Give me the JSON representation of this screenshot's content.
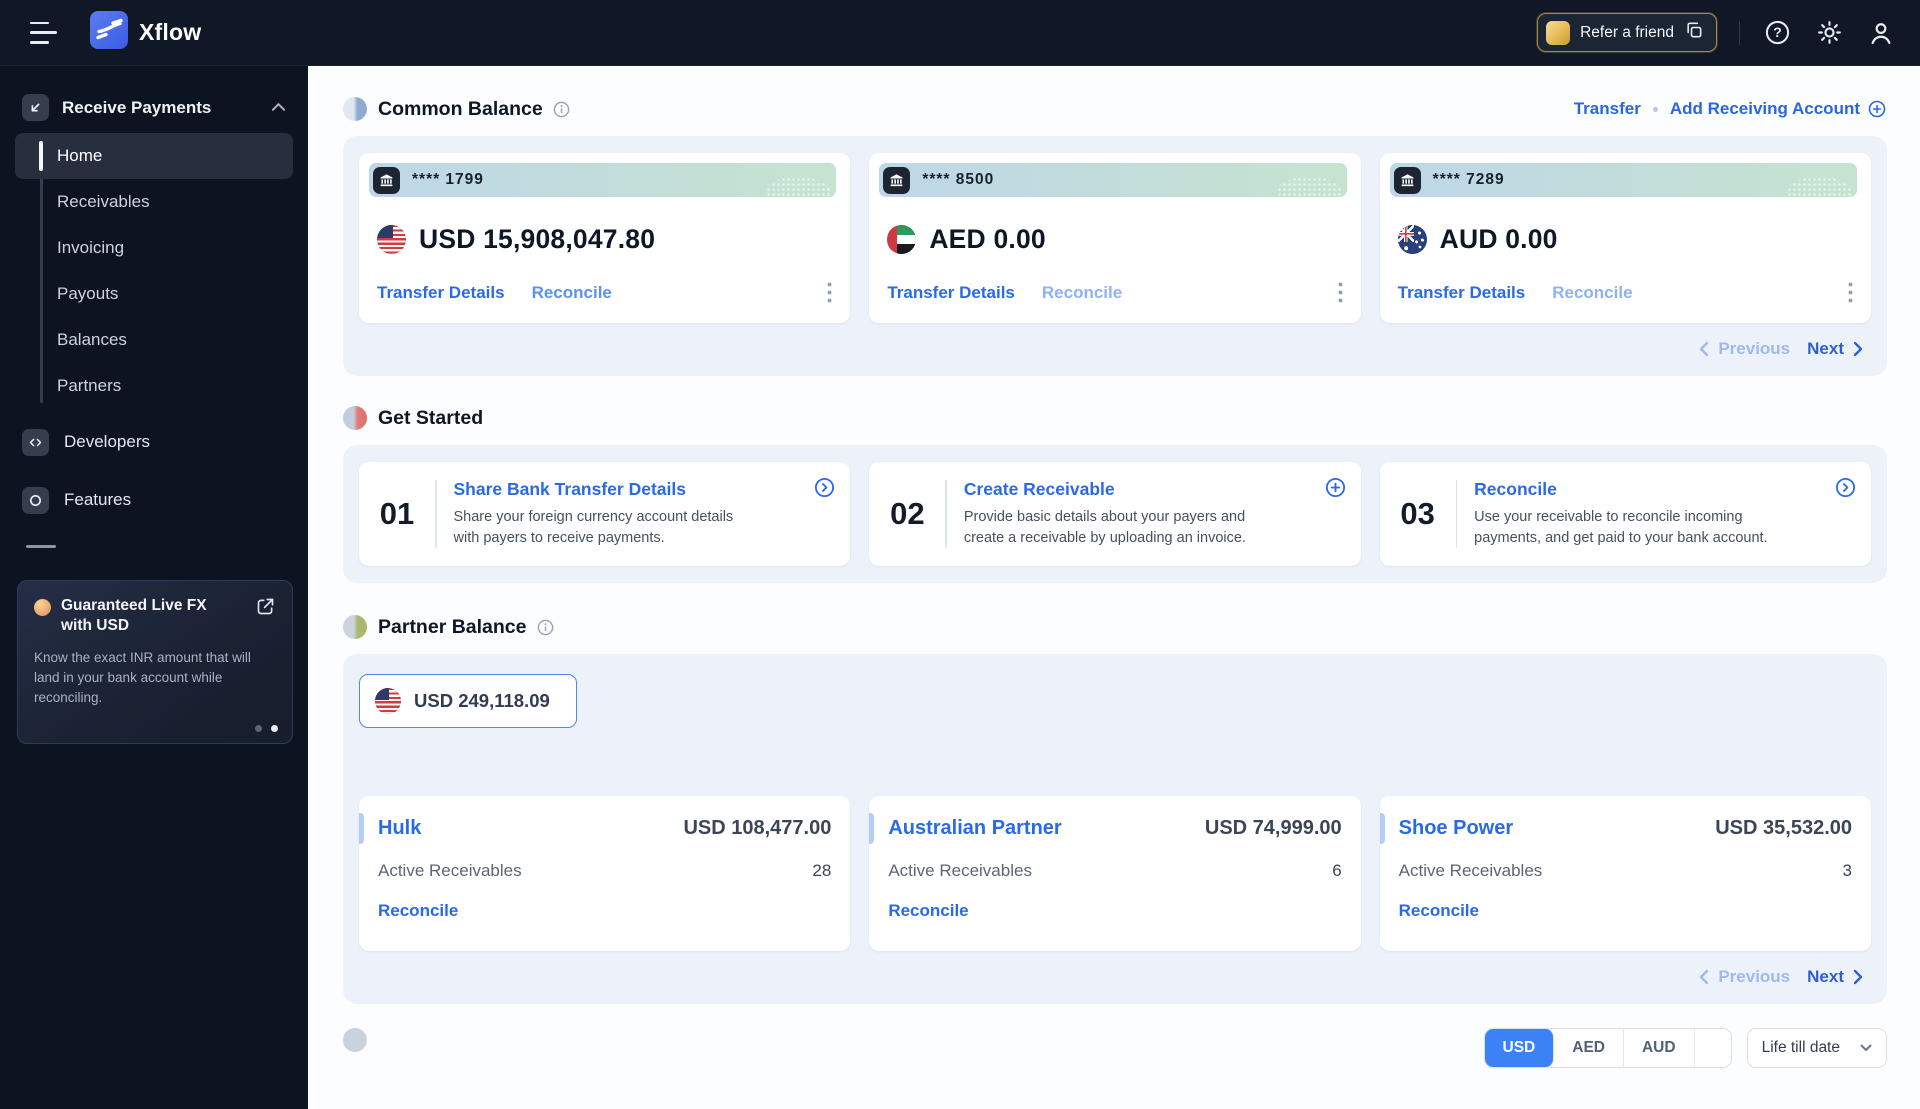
{
  "topnav": {
    "brand": "Xflow",
    "refer_label": "Refer a friend"
  },
  "sidebar": {
    "section_label": "Receive Payments",
    "items": [
      {
        "label": "Home",
        "active": true
      },
      {
        "label": "Receivables"
      },
      {
        "label": "Invoicing"
      },
      {
        "label": "Payouts"
      },
      {
        "label": "Balances"
      },
      {
        "label": "Partners"
      }
    ],
    "developers_label": "Developers",
    "features_label": "Features",
    "promo": {
      "title": "Guaranteed Live FX with USD",
      "body": "Know the exact INR amount that will land in your bank account while reconciling."
    }
  },
  "header_actions": {
    "transfer": "Transfer",
    "add_receiving": "Add Receiving Account"
  },
  "common_balance": {
    "title": "Common Balance",
    "cards": [
      {
        "masked": "**** 1799",
        "amount": "USD 15,908,047.80",
        "flag": "us-flag",
        "transfer_details": "Transfer Details",
        "reconcile": "Reconcile"
      },
      {
        "masked": "**** 8500",
        "amount": "AED 0.00",
        "flag": "ae-flag",
        "transfer_details": "Transfer Details",
        "reconcile": "Reconcile"
      },
      {
        "masked": "**** 7289",
        "amount": "AUD 0.00",
        "flag": "au-flag",
        "transfer_details": "Transfer Details",
        "reconcile": "Reconcile"
      }
    ],
    "pagination": {
      "previous": "Previous",
      "next": "Next"
    }
  },
  "get_started": {
    "title": "Get Started",
    "steps": [
      {
        "num": "01",
        "title": "Share Bank Transfer Details",
        "desc": "Share your foreign currency account details with payers to receive payments.",
        "icon": "chevron-circle-icon"
      },
      {
        "num": "02",
        "title": "Create Receivable",
        "desc": "Provide basic details about your payers and create a receivable by uploading an invoice.",
        "icon": "plus-circle-icon"
      },
      {
        "num": "03",
        "title": "Reconcile",
        "desc": "Use your receivable to reconcile incoming payments, and get paid to your bank account.",
        "icon": "chevron-circle-icon"
      }
    ]
  },
  "partner_balance": {
    "title": "Partner Balance",
    "chip_amount": "USD 249,118.09",
    "cards": [
      {
        "name": "Hulk",
        "amount": "USD 108,477.00",
        "metric_label": "Active Receivables",
        "metric_value": "28",
        "link": "Reconcile"
      },
      {
        "name": "Australian Partner",
        "amount": "USD 74,999.00",
        "metric_label": "Active Receivables",
        "metric_value": "6",
        "link": "Reconcile"
      },
      {
        "name": "Shoe Power",
        "amount": "USD 35,532.00",
        "metric_label": "Active Receivables",
        "metric_value": "3",
        "link": "Reconcile"
      }
    ],
    "pagination": {
      "previous": "Previous",
      "next": "Next"
    }
  },
  "bottom_bar": {
    "currencies": [
      "USD",
      "AED",
      "AUD",
      ""
    ],
    "active_currency": "USD",
    "range_filter": "Life till date"
  },
  "colors": {
    "nav_bg": "#101828",
    "sidebar_bg": "#0d1421",
    "container_bg": "#edf2fa",
    "accent_blue": "#2a6ae6",
    "link_light_blue": "#8fb2f3",
    "toggle_active_blue": "#3b82f6",
    "refer_gold": "#caa34a"
  }
}
